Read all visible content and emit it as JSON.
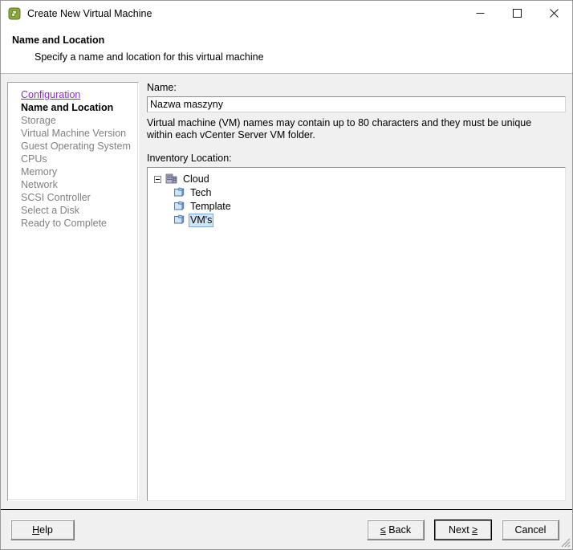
{
  "window": {
    "title": "Create New Virtual Machine",
    "app_icon": "vm-app-icon",
    "controls": {
      "minimize": "minimize-icon",
      "maximize": "maximize-icon",
      "close": "close-icon"
    }
  },
  "header": {
    "title": "Name and Location",
    "subtitle": "Specify a name and location for this virtual machine"
  },
  "sidebar": {
    "items": [
      {
        "label": "Configuration",
        "state": "link"
      },
      {
        "label": "Name and Location",
        "state": "current"
      },
      {
        "label": "Storage",
        "state": "disabled"
      },
      {
        "label": "Virtual Machine Version",
        "state": "disabled"
      },
      {
        "label": "Guest Operating System",
        "state": "disabled"
      },
      {
        "label": "CPUs",
        "state": "disabled"
      },
      {
        "label": "Memory",
        "state": "disabled"
      },
      {
        "label": "Network",
        "state": "disabled"
      },
      {
        "label": "SCSI Controller",
        "state": "disabled"
      },
      {
        "label": "Select a Disk",
        "state": "disabled"
      },
      {
        "label": "Ready to Complete",
        "state": "disabled"
      }
    ]
  },
  "main": {
    "name_label": "Name:",
    "name_value": "Nazwa maszyny",
    "name_placeholder": "",
    "name_help": "Virtual machine (VM) names may contain up to 80 characters and they must be unique within each vCenter Server VM folder.",
    "inventory_label": "Inventory Location:",
    "tree": {
      "root": {
        "label": "Cloud",
        "icon": "datacenter-icon",
        "expanded": true
      },
      "children": [
        {
          "label": "Tech",
          "icon": "folder-icon",
          "selected": false
        },
        {
          "label": "Template",
          "icon": "folder-icon",
          "selected": false
        },
        {
          "label": "VM's",
          "icon": "folder-icon",
          "selected": true
        }
      ]
    }
  },
  "footer": {
    "help_label": "Help",
    "help_accel": "H",
    "back_label": "Back",
    "back_prefix": "≤",
    "next_label": "Next",
    "next_suffix": "≥",
    "cancel_label": "Cancel"
  },
  "colors": {
    "link": "#8a2be2",
    "disabled_text": "#808080",
    "selection_fill": "#cfe4f7",
    "selection_border": "#7aa9dd",
    "dialog_bg": "#f0f0f0",
    "panel_bg": "#ffffff",
    "app_icon_green": "#8aa83c"
  }
}
